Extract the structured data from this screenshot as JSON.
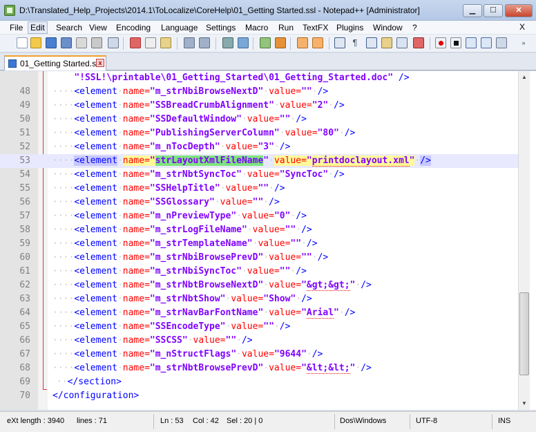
{
  "window": {
    "title": "D:\\Translated_Help_Projects\\2014.1\\ToLocalize\\CoreHelp\\01_Getting Started.ssl - Notepad++ [Administrator]",
    "close_glyph": "✕",
    "min_glyph": "▁",
    "max_glyph": "☐"
  },
  "menu": {
    "items": [
      "File",
      "Edit",
      "Search",
      "View",
      "Encoding",
      "Language",
      "Settings",
      "Macro",
      "Run",
      "TextFX",
      "Plugins",
      "Window",
      "?"
    ],
    "close": "X"
  },
  "tab": {
    "label": "01_Getting Started.ssl",
    "close": "x"
  },
  "editor": {
    "current_line": 53,
    "partial_line": {
      "text": "\"!SSL!\\printable\\01_Getting_Started\\01_Getting_Started.doc\"",
      "close": " />"
    },
    "lines": [
      {
        "n": "48",
        "name": "m_strNbiBrowseNextD",
        "value": ""
      },
      {
        "n": "49",
        "name": "SSBreadCrumbAlignment",
        "value": "2"
      },
      {
        "n": "50",
        "name": "SSDefaultWindow",
        "value": ""
      },
      {
        "n": "51",
        "name": "PublishingServerColumn",
        "value": "80"
      },
      {
        "n": "52",
        "name": "m_nTocDepth",
        "value": "3"
      },
      {
        "n": "53",
        "name": "strLayoutXmlFileName",
        "value": "printdoclayout.xml"
      },
      {
        "n": "54",
        "name": "m_strNbtSyncToc",
        "value": "SyncToc"
      },
      {
        "n": "55",
        "name": "SSHelpTitle",
        "value": ""
      },
      {
        "n": "56",
        "name": "SSGlossary",
        "value": ""
      },
      {
        "n": "57",
        "name": "m_nPreviewType",
        "value": "0"
      },
      {
        "n": "58",
        "name": "m_strLogFileName",
        "value": ""
      },
      {
        "n": "59",
        "name": "m_strTemplateName",
        "value": ""
      },
      {
        "n": "60",
        "name": "m_strNbiBrowsePrevD",
        "value": ""
      },
      {
        "n": "61",
        "name": "m_strNbiSyncToc",
        "value": ""
      },
      {
        "n": "62",
        "name": "m_strNbtBrowseNextD",
        "value": "&gt;&gt;"
      },
      {
        "n": "63",
        "name": "m_strNbtShow",
        "value": "Show"
      },
      {
        "n": "64",
        "name": "m_strNavBarFontName",
        "value": "Arial"
      },
      {
        "n": "65",
        "name": "SSEncodeType",
        "value": ""
      },
      {
        "n": "66",
        "name": "SSCSS",
        "value": ""
      },
      {
        "n": "67",
        "name": "m_nStructFlags",
        "value": "9644"
      },
      {
        "n": "68",
        "name": "m_strNbtBrowsePrevD",
        "value": "&lt;&lt;"
      }
    ],
    "closing": [
      {
        "n": "69",
        "text": "</section>"
      },
      {
        "n": "70",
        "text": "</configuration>"
      }
    ],
    "tokens": {
      "open": "<element",
      "name_attr": "name=",
      "value_attr": "value=",
      "close": "/>"
    }
  },
  "status": {
    "type": "eXt length : 3940",
    "lines": "lines : 71",
    "ln": "Ln : 53",
    "col": "Col : 42",
    "sel": "Sel : 20 | 0",
    "eol": "Dos\\Windows",
    "enc": "UTF-8",
    "mode": "INS"
  },
  "colors": {
    "tag": "#0000ff",
    "attr": "#ff0000",
    "value": "#8000ff",
    "current_line": "#e8e8ff",
    "tab_accent": "#f0a030"
  }
}
